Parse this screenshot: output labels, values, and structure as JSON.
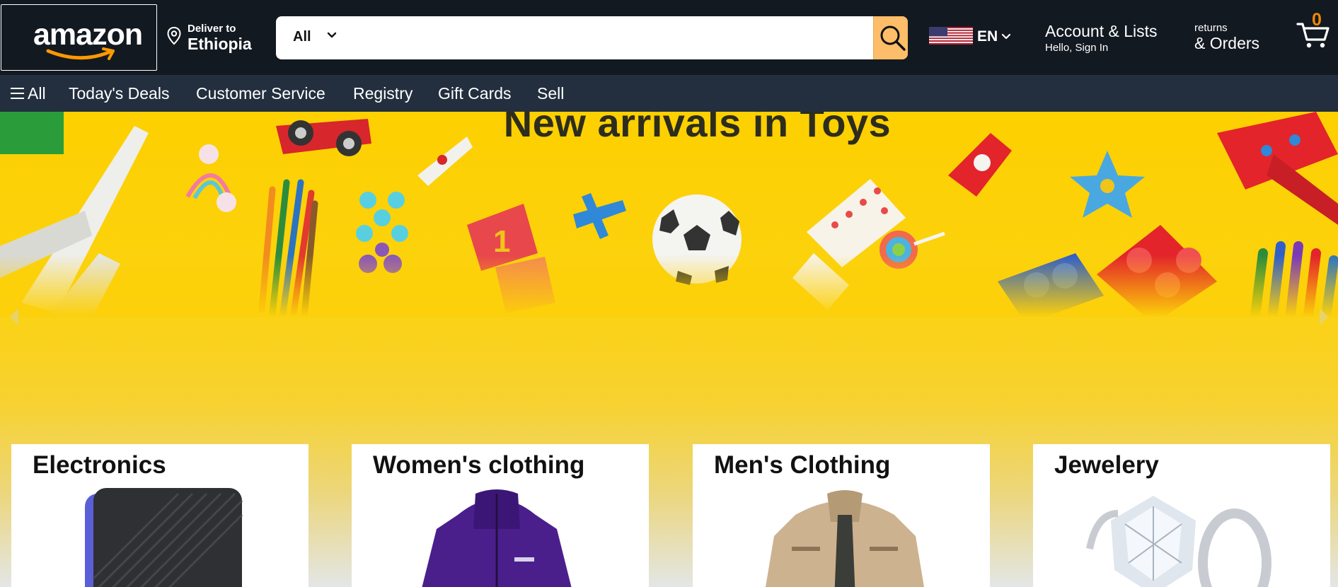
{
  "header": {
    "logo_text": "amazon",
    "deliver_label": "Deliver to",
    "deliver_location": "Ethiopia",
    "search": {
      "category": "All",
      "placeholder": "",
      "value": ""
    },
    "language": "EN",
    "account": {
      "title": "Account & Lists",
      "greeting": "Hello, Sign In"
    },
    "orders": {
      "line1": "returns",
      "line2": "& Orders"
    },
    "cart_count": "0"
  },
  "subnav": {
    "items": [
      {
        "label": "All"
      },
      {
        "label": "Today's Deals"
      },
      {
        "label": "Customer Service"
      },
      {
        "label": "Registry"
      },
      {
        "label": "Gift Cards"
      },
      {
        "label": "Sell"
      }
    ]
  },
  "hero": {
    "title": "New arrivals in Toys"
  },
  "categories": [
    {
      "title": "Electronics",
      "image": "external-hard-drive"
    },
    {
      "title": "Women's clothing",
      "image": "purple-jacket"
    },
    {
      "title": "Men's Clothing",
      "image": "khaki-jacket"
    },
    {
      "title": "Jewelery",
      "image": "diamond-ring"
    }
  ],
  "colors": {
    "nav_dark": "#131921",
    "subnav": "#232f3e",
    "search_button": "#febd69",
    "cart_count": "#f08804",
    "hero_yellow": "#fdd000"
  }
}
